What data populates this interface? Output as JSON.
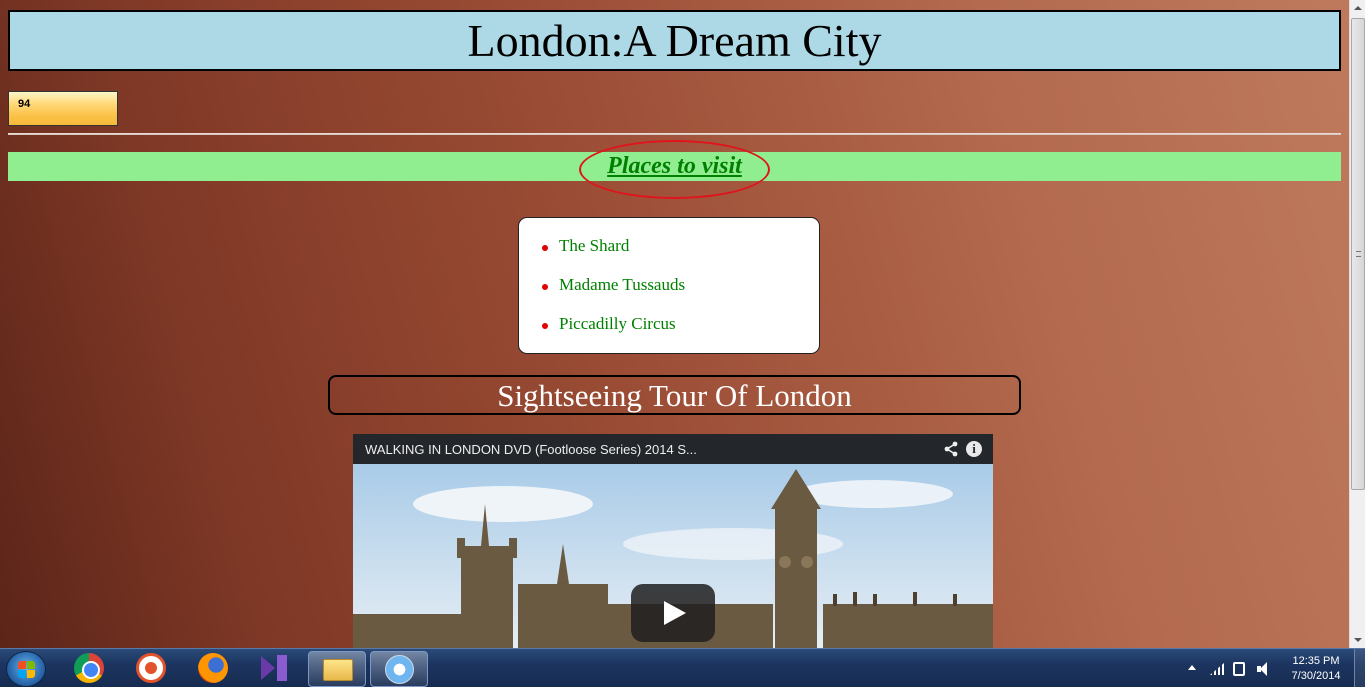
{
  "page": {
    "title": "London:A Dream City",
    "counter_value": "94",
    "places_heading": "Places to visit",
    "places": [
      "The Shard",
      "Madame Tussauds",
      "Piccadilly Circus"
    ],
    "tour_heading": "Sightseeing Tour Of London"
  },
  "video": {
    "title": "WALKING IN LONDON DVD (Footloose Series) 2014 S...",
    "icons": [
      "share-icon",
      "info-icon",
      "play-icon"
    ]
  },
  "taskbar": {
    "apps": [
      "start-button",
      "chrome-icon",
      "app-icon",
      "firefox-icon",
      "visual-studio-icon",
      "windows-explorer",
      "safari"
    ],
    "tray_icons": [
      "show-hidden-icons-arrow",
      "network-signal-icon",
      "power-icon",
      "volume-icon"
    ],
    "time": "12:35 PM",
    "date": "7/30/2014"
  },
  "colors": {
    "title_bg": "#add8e6",
    "places_bar_bg": "#90ee90",
    "link_green": "#008000",
    "annotation_red": "#e0141c",
    "bullet_red": "#e00000"
  }
}
